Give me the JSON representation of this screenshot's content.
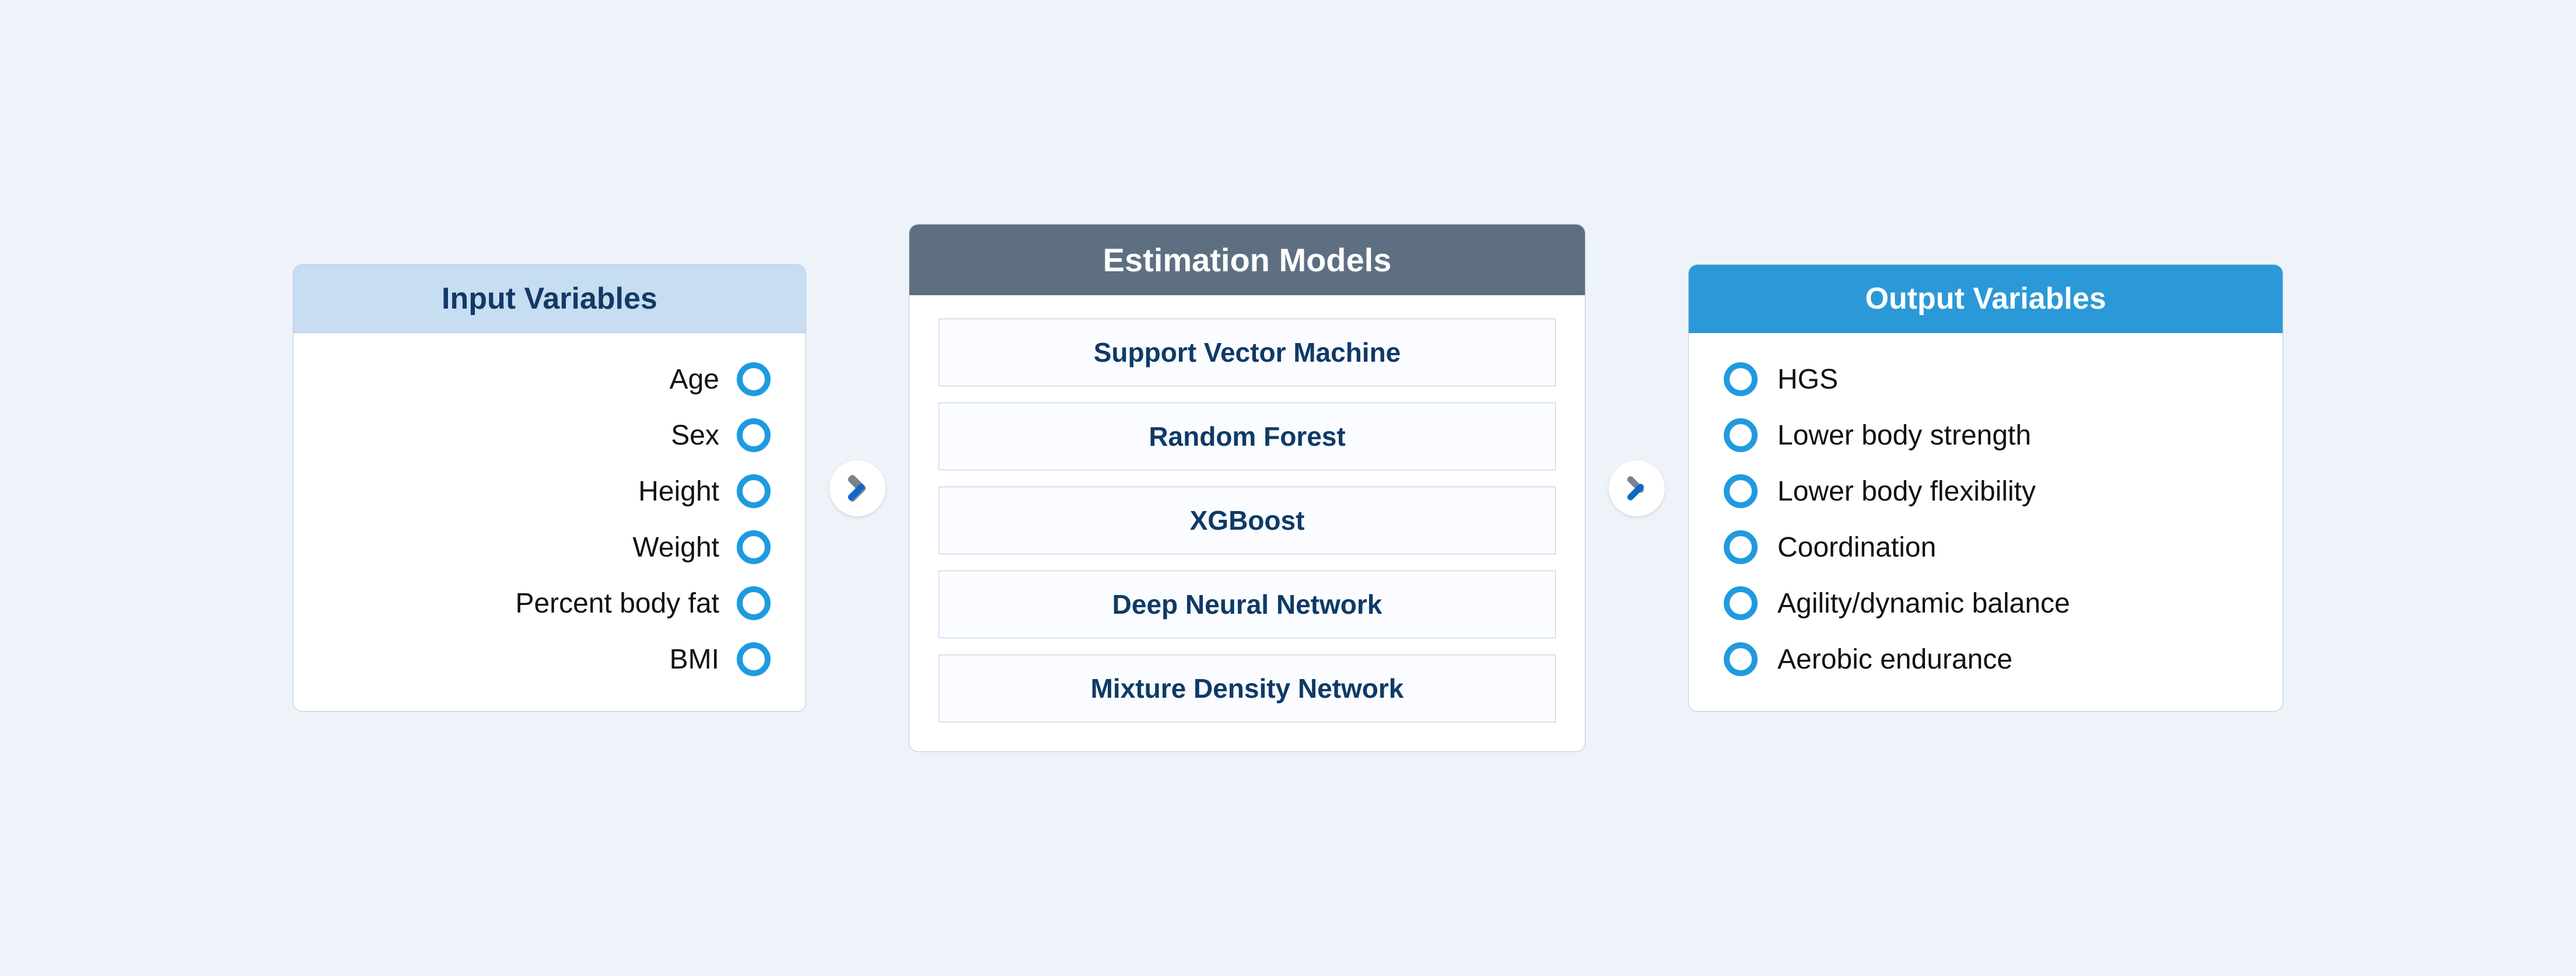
{
  "input": {
    "title": "Input Variables",
    "items": [
      "Age",
      "Sex",
      "Height",
      "Weight",
      "Percent body fat",
      "BMI"
    ]
  },
  "models": {
    "title": "Estimation Models",
    "items": [
      "Support Vector Machine",
      "Random Forest",
      "XGBoost",
      "Deep Neural Network",
      "Mixture Density Network"
    ]
  },
  "output": {
    "title": "Output Variables",
    "items": [
      "HGS",
      "Lower body strength",
      "Lower body flexibility",
      "Coordination",
      "Agility/dynamic balance",
      "Aerobic endurance"
    ]
  }
}
